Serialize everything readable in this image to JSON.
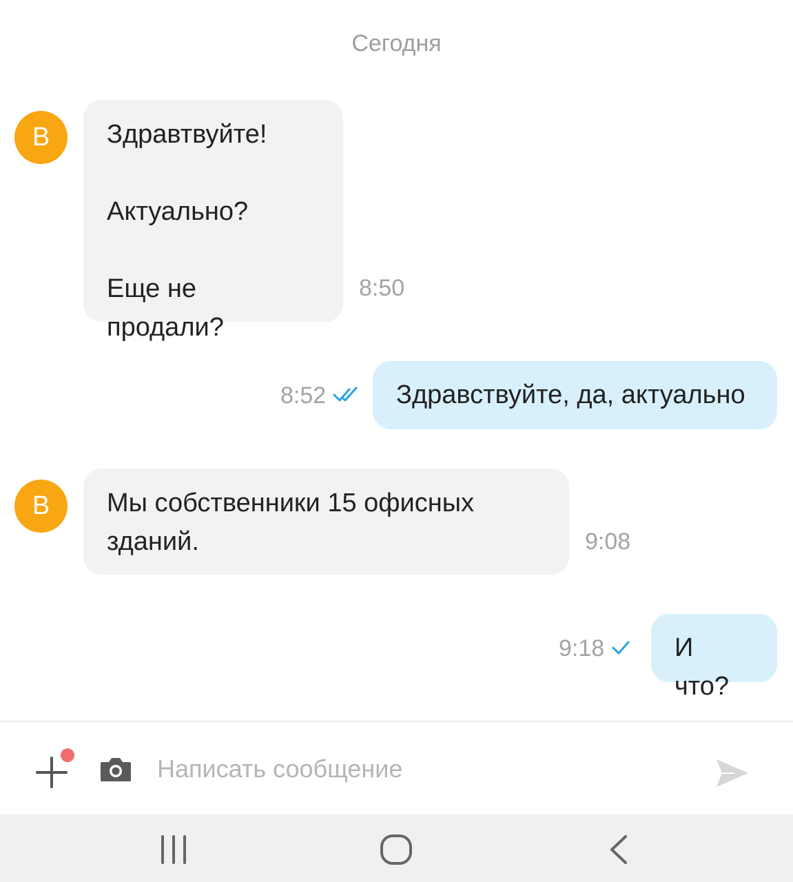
{
  "chat": {
    "date_label": "Сегодня",
    "messages": [
      {
        "direction": "incoming",
        "avatar_letter": "В",
        "lines": [
          "Здравтвуйте!",
          "Актуально?",
          "Еще не продали?"
        ],
        "time": "8:50"
      },
      {
        "direction": "outgoing",
        "text": "Здравствуйте, да, актуально",
        "time": "8:52",
        "status": "read-double-check-icon"
      },
      {
        "direction": "incoming",
        "avatar_letter": "В",
        "lines": [
          "Мы собственники 15 офисных",
          "зданий."
        ],
        "time": "9:08"
      },
      {
        "direction": "outgoing",
        "text": "И что?",
        "time": "9:18",
        "status": "sent-single-check-icon"
      }
    ]
  },
  "composer": {
    "placeholder": "Написать сообщение",
    "value": "",
    "icons": [
      "plus-icon",
      "camera-icon",
      "send-icon"
    ],
    "has_notification_dot": true
  },
  "navbar": {
    "icons": [
      "recent-apps-icon",
      "home-icon",
      "back-icon"
    ]
  },
  "colors": {
    "avatar": "#f8a612",
    "incoming_bubble": "#f2f2f2",
    "outgoing_bubble": "#d8f0fc",
    "check_mark": "#2aa3e0",
    "notification_dot": "#f26d6d"
  }
}
